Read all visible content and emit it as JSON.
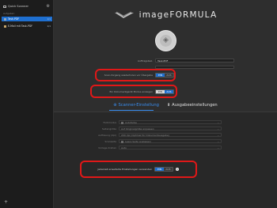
{
  "sidebar": {
    "title": "Quick Scanner",
    "section": "Aufgaben",
    "items": [
      {
        "label": "Task-PDF",
        "badge": "1/1",
        "active": true
      },
      {
        "label": "E-Mail mit Task-PDF",
        "badge": "1/1",
        "active": false
      }
    ],
    "gear_icon": "gear-icon",
    "add_label": "+"
  },
  "header": {
    "logo_text": "imageFORMULA"
  },
  "start": {
    "icon": "diamond-start-icon",
    "glyph": "◈"
  },
  "settings_top": {
    "name_label": "Auftragsbez.",
    "name_value": "Task-PDF",
    "row1_label": "Scan-Vorgang wiederholen vor Übergabe",
    "row1_on": "EIN",
    "row1_off": "AUS",
    "row2_label": "Ein Dokumentgerät Modus anzeigen",
    "row2_on": "EIN",
    "row2_off": "AUS"
  },
  "tabs": {
    "scan": "Scanner-Einstellung",
    "output": "Ausgabeeinstellungen"
  },
  "scanner_settings": [
    {
      "label": "Farbmodus",
      "value": "Autofarbe"
    },
    {
      "label": "Seitengröße",
      "value": "Auf Originalgröße anpassen"
    },
    {
      "label": "Auflösung (dpi)",
      "value": "200 dpi (Optimal für Dokumentausgabe)"
    },
    {
      "label": "Scanseite",
      "value": "Leere Seite auslassen"
    },
    {
      "label": "Vorlage drehen",
      "value": "Auto"
    }
  ],
  "advanced": {
    "label": "Jederzeit erweiterte Einstellungen verwenden",
    "on": "EIN",
    "off": "AUS",
    "info": "i"
  },
  "colors": {
    "accent": "#1e6fd0",
    "highlight_ring": "#e01818"
  }
}
